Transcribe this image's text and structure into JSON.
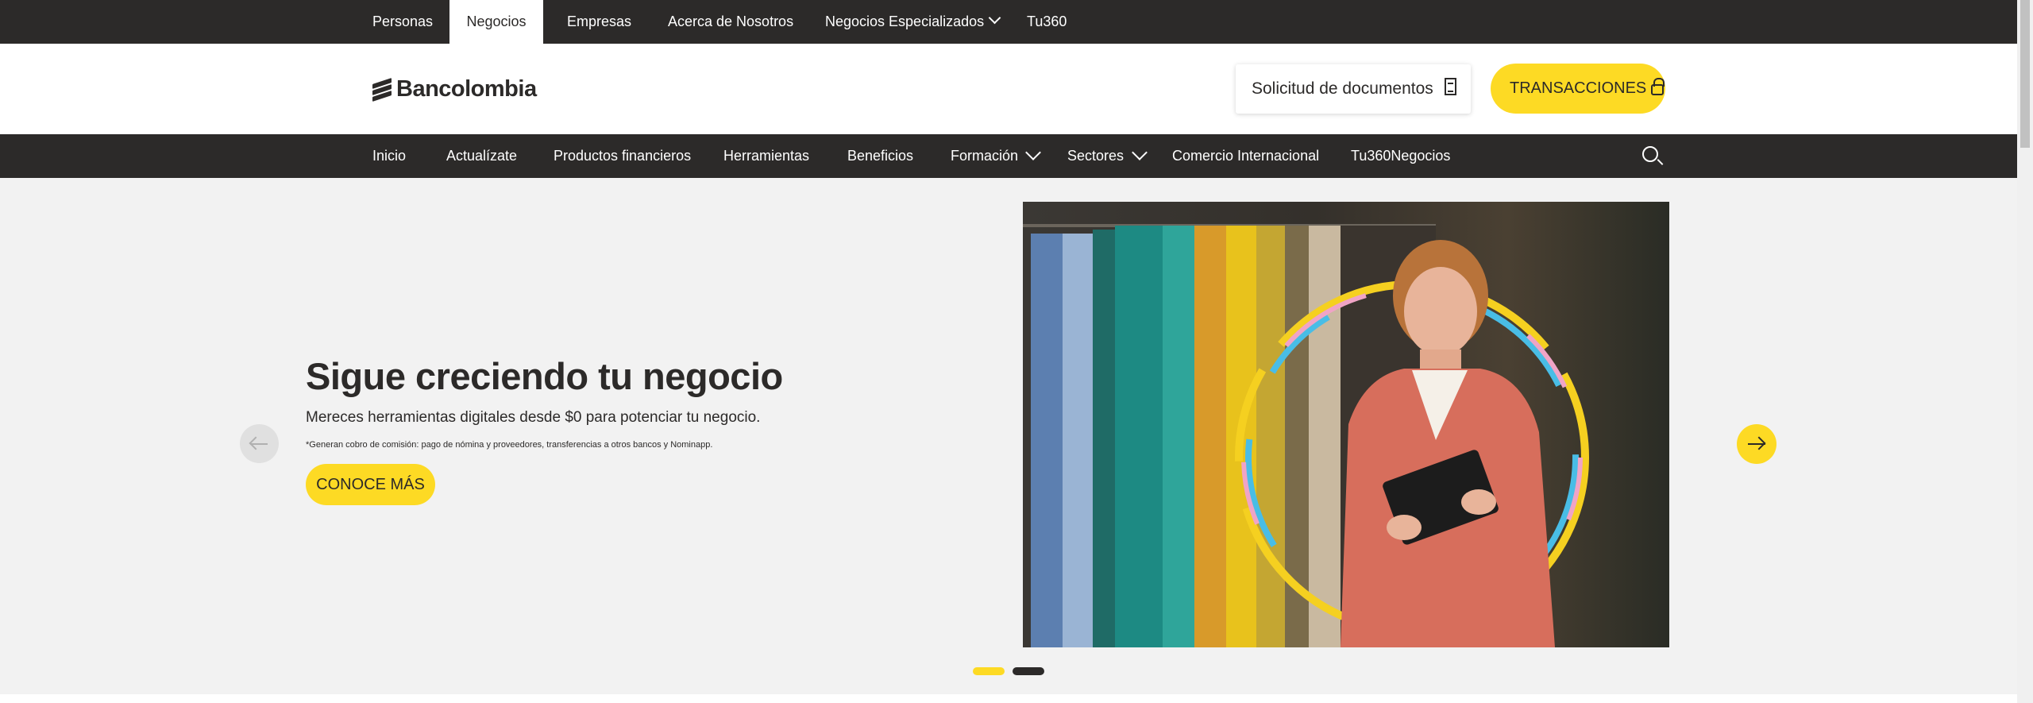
{
  "topbar": {
    "tabs": [
      {
        "label": "Personas"
      },
      {
        "label": "Negocios"
      },
      {
        "label": "Empresas"
      },
      {
        "label": "Acerca de Nosotros"
      },
      {
        "label": "Negocios Especializados"
      },
      {
        "label": "Tu360"
      }
    ],
    "active_tab": "Negocios"
  },
  "header": {
    "logo_text": "Bancolombia",
    "doc_button_label": "Solicitud de documentos",
    "transactions_button_label": "TRANSACCIONES"
  },
  "mainnav": {
    "items": [
      {
        "label": "Inicio"
      },
      {
        "label": "Actualízate"
      },
      {
        "label": "Productos financieros"
      },
      {
        "label": "Herramientas"
      },
      {
        "label": "Beneficios"
      },
      {
        "label": "Formación"
      },
      {
        "label": "Sectores"
      },
      {
        "label": "Comercio Internacional"
      },
      {
        "label": "Tu360Negocios"
      }
    ]
  },
  "hero": {
    "title": "Sigue creciendo tu negocio",
    "subtitle": "Mereces herramientas digitales desde $0 para potenciar tu negocio.",
    "note": "*Generan cobro de comisión: pago de nómina y proveedores, transferencias a otros bancos y Nominapp.",
    "cta_label": "CONOCE MÁS",
    "slides_total": 2,
    "active_slide": 1
  },
  "colors": {
    "brand_yellow": "#fdda24",
    "dark": "#2c2a29",
    "hero_bg": "#f2f2f2"
  }
}
